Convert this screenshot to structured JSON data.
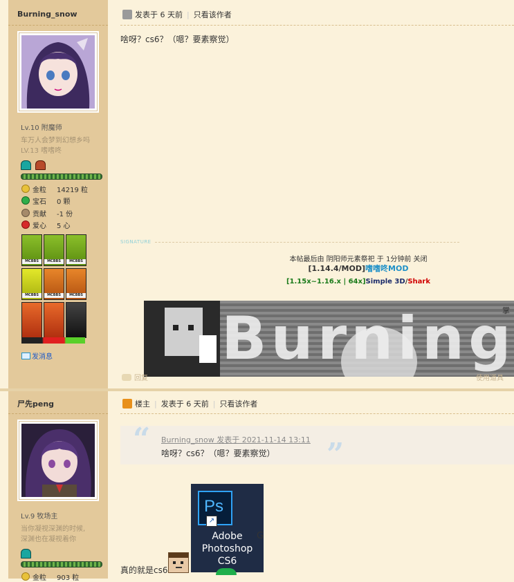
{
  "posts": [
    {
      "username": "Burning_snow",
      "level": "Lv.10 附魔师",
      "bio": [
        "车万人会梦到幻想乡吗",
        "LV.13 嗜嗜咚"
      ],
      "stats": [
        {
          "label": "金粒",
          "value": "14219 粒"
        },
        {
          "label": "宝石",
          "value": "0 颗"
        },
        {
          "label": "贡献",
          "value": "-1 份"
        },
        {
          "label": "爱心",
          "value": "5 心"
        }
      ],
      "medal_caption": "MCBBS",
      "send_message": "发消息",
      "meta": {
        "posted": "发表于 6 天前",
        "only_author": "只看该作者"
      },
      "content": "啥呀？cs6？（嗯？要素察觉）",
      "signature_label": "SIGNATURE",
      "edit_notice": "本帖最后由 阴阳师元素祭祀 于 1分钟前 关闭",
      "sig_line1": {
        "prefix": "[1.14.4/MOD]",
        "highlight": "嗜嗜咚MOD"
      },
      "sig_line2": {
        "part1": "[1.15x~1.16.x | 64x]",
        "part2": "Simple 3D",
        "slash": "/",
        "part3": "Shark"
      },
      "banner_text": "Burning",
      "banner_small": "掌",
      "reply": "回复",
      "report": "使用道具"
    },
    {
      "username": "尸先peng",
      "level": "Lv.9 牧场主",
      "bio": [
        "当你凝视深渊的时候,",
        "深渊也在凝视着你"
      ],
      "stats": [
        {
          "label": "金粒",
          "value": "903 粒"
        }
      ],
      "meta": {
        "op_badge": "楼主",
        "posted": "发表于 6 天前",
        "only_author": "只看该作者"
      },
      "quote": {
        "header": "Burning_snow 发表于 2021-11-14 13:11",
        "text": "啥呀？cs6？（嗯？要素察觉）"
      },
      "reply_text": "真的就是cs6",
      "ps_icon": {
        "abbr": "Ps",
        "line1": "Adobe",
        "line2": "Photoshop",
        "line3": "CS6"
      },
      "stray_char": "G"
    }
  ],
  "colors": {
    "sidebar": "#e3c99b",
    "bg": "#fbf2db",
    "link_blue": "#1e90c8",
    "green": "#1a7a1a",
    "red": "#d00000"
  }
}
